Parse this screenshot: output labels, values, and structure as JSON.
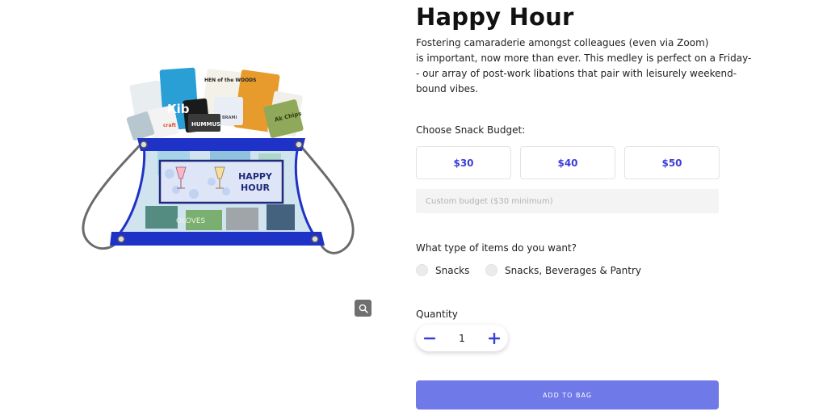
{
  "product": {
    "title": "Happy Hour",
    "description_lines": [
      "Fostering camaraderie amongst colleagues (even via Zoom)",
      "is important, now more than ever. This medley is perfect on a Friday-",
      "- our array of post-work libations that pair with leisurely weekend-",
      "bound vibes."
    ],
    "image_banner": {
      "line1": "HAPPY",
      "line2": "HOUR"
    },
    "image_package_labels": [
      "Kib",
      "HEN of the WOODS",
      "HUMMUS",
      "craft",
      "Ak Chips",
      "OLOVES",
      "BRAMI"
    ]
  },
  "budget": {
    "label": "Choose Snack Budget:",
    "options": [
      "$30",
      "$40",
      "$50"
    ],
    "custom_placeholder": "Custom budget ($30 minimum)",
    "custom_value": ""
  },
  "items": {
    "label": "What type of items do you want?",
    "options": [
      "Snacks",
      "Snacks, Beverages & Pantry"
    ]
  },
  "quantity": {
    "label": "Quantity",
    "value": "1",
    "minus_icon": "minus-icon",
    "plus_icon": "plus-icon"
  },
  "actions": {
    "add_to_bag_label": "ADD TO BAG",
    "zoom_icon": "magnifier-icon"
  },
  "colors": {
    "accent": "#3b3fd6",
    "button": "#7079e8",
    "bag_blue": "#1f32c8"
  }
}
